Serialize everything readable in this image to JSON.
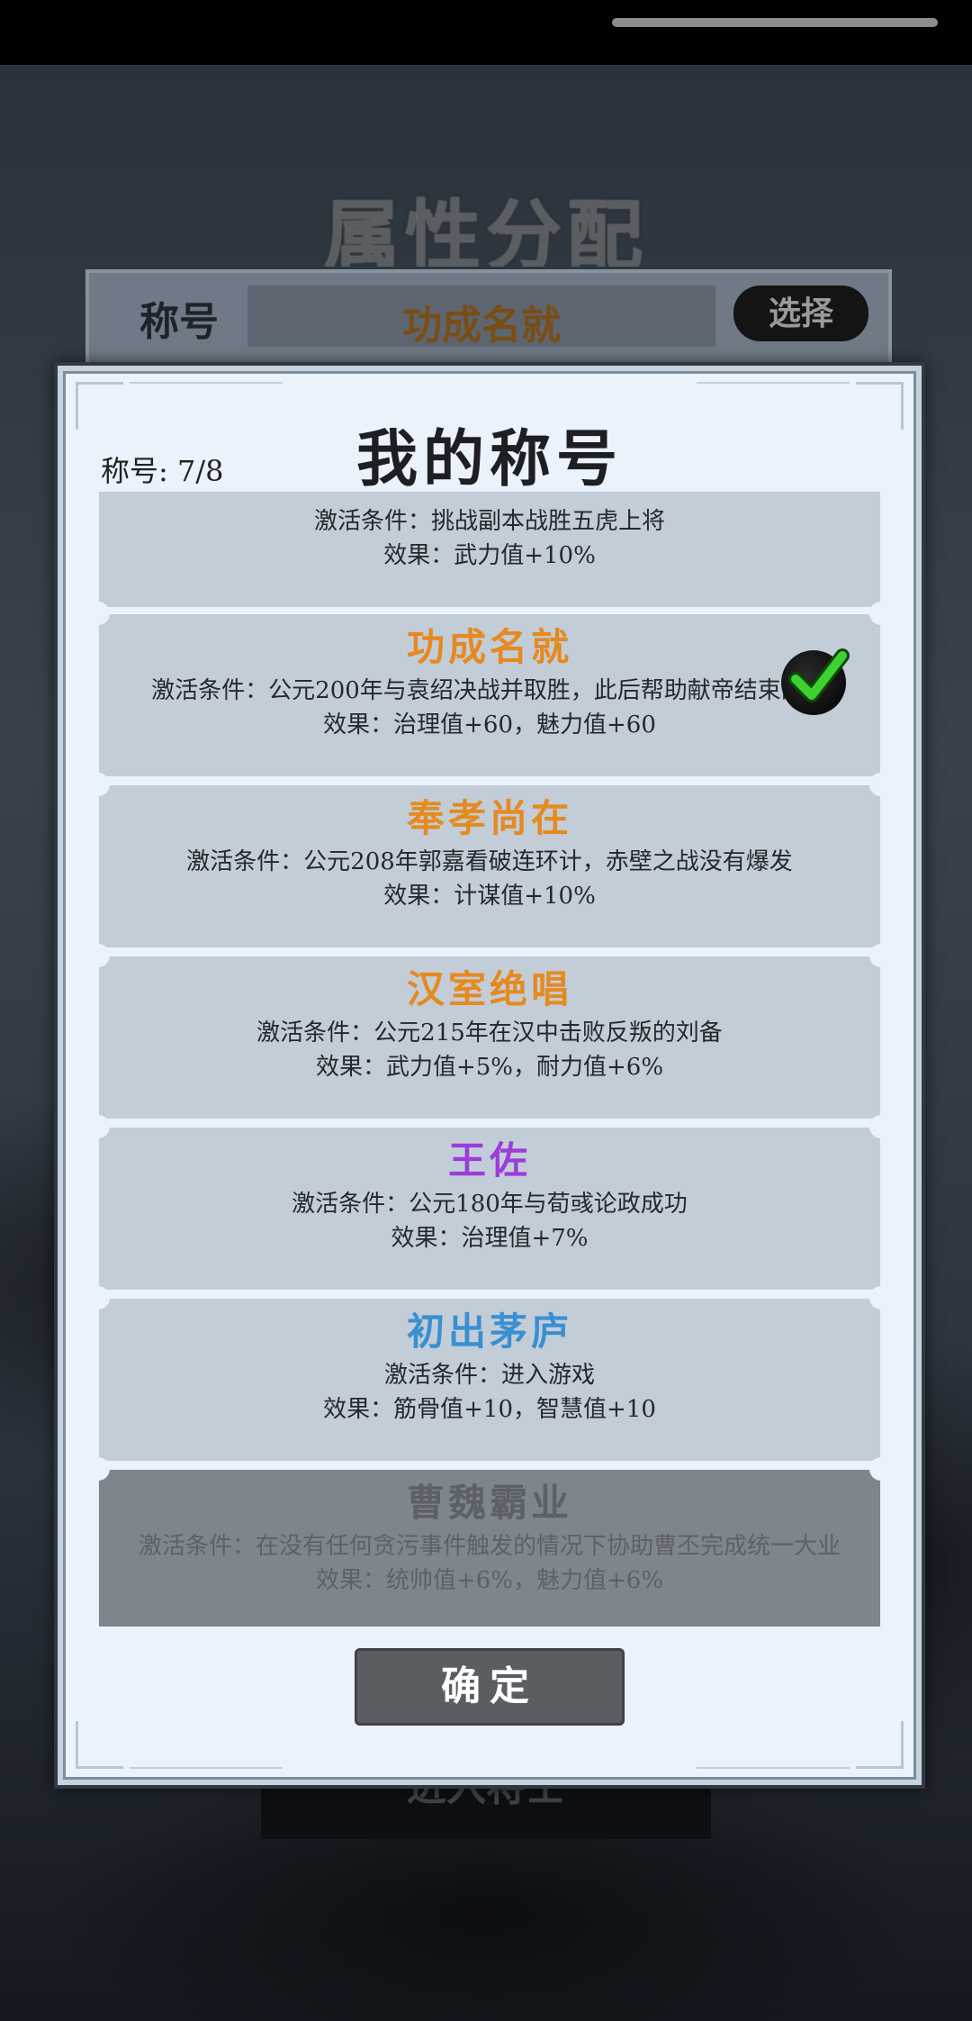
{
  "background": {
    "title": "属性分配",
    "title_label": "称号",
    "title_value": "功成名就",
    "choose_label": "选择",
    "bottom_button": "进入将士"
  },
  "modal": {
    "title": "我的称号",
    "count_label": "称号: 7/8",
    "cards": [
      {
        "title": "",
        "condition": "激活条件：挑战副本战胜五虎上将",
        "effect": "效果：武力值+10%",
        "title_color": "#e58a1f",
        "locked": false
      },
      {
        "title": "功成名就",
        "condition": "激活条件：公元200年与袁绍决战并取胜，此后帮助献帝结束乱世",
        "effect": "效果：治理值+60，魅力值+60",
        "title_color": "#e58a1f",
        "locked": false,
        "selected": true
      },
      {
        "title": "奉孝尚在",
        "condition": "激活条件：公元208年郭嘉看破连环计，赤壁之战没有爆发",
        "effect": "效果：计谋值+10%",
        "title_color": "#e58a1f",
        "locked": false
      },
      {
        "title": "汉室绝唱",
        "condition": "激活条件：公元215年在汉中击败反叛的刘备",
        "effect": "效果：武力值+5%，耐力值+6%",
        "title_color": "#e58a1f",
        "locked": false
      },
      {
        "title": "王佐",
        "condition": "激活条件：公元180年与荀彧论政成功",
        "effect": "效果：治理值+7%",
        "title_color": "#9b3ddb",
        "locked": false
      },
      {
        "title": "初出茅庐",
        "condition": "激活条件：进入游戏",
        "effect": "效果：筋骨值+10，智慧值+10",
        "title_color": "#3a8fd0",
        "locked": false
      },
      {
        "title": "曹魏霸业",
        "condition": "激活条件：在没有任何贪污事件触发的情况下协助曹丕完成统一大业",
        "effect": "效果：统帅值+6%，魅力值+6%",
        "title_color": "#5c6167",
        "locked": true
      }
    ],
    "ok_label": "确定"
  },
  "colors": {
    "modal_bg": "#eaf2fb",
    "card_bg": "#c3cdd8",
    "locked_card_bg": "#7f858c",
    "orange": "#e58a1f",
    "purple": "#9b3ddb",
    "blue": "#3a8fd0",
    "check_green": "#22b21e"
  },
  "icons": {
    "selected": "check-icon"
  }
}
